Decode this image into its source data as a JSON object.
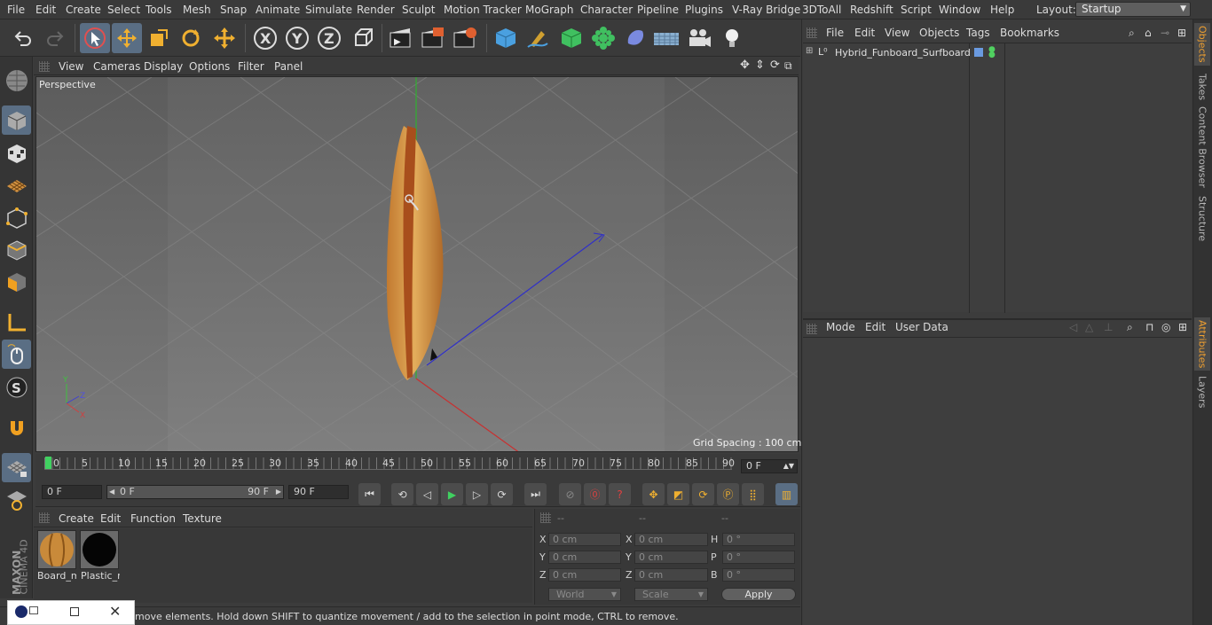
{
  "menubar": {
    "items": [
      "File",
      "Edit",
      "Create",
      "Select",
      "Tools",
      "Mesh",
      "Snap",
      "Animate",
      "Simulate",
      "Render",
      "Sculpt",
      "Motion Tracker",
      "MoGraph",
      "Character",
      "Pipeline",
      "Plugins",
      "V-Ray Bridge",
      "3DToAll",
      "Redshift",
      "Script",
      "Window",
      "Help"
    ],
    "layout_label": "Layout:",
    "layout_value": "Startup"
  },
  "toolbar": {
    "buttons": [
      "undo-icon",
      "redo-icon",
      "select-arrow-icon",
      "move-icon",
      "scale-icon",
      "rotate-icon",
      "move-alt-icon",
      "x-axis-icon",
      "y-axis-icon",
      "z-axis-icon",
      "coordinate-system-icon",
      "render-view-icon",
      "render-picture-viewer-icon",
      "render-settings-icon",
      "cube-icon",
      "pen-icon",
      "generator-icon",
      "cloner-icon",
      "deformer-icon",
      "floor-icon",
      "camera-icon",
      "light-icon"
    ]
  },
  "viewport": {
    "menu": [
      "View",
      "Cameras",
      "Display",
      "Options",
      "Filter",
      "Panel"
    ],
    "label": "Perspective",
    "grid_spacing": "Grid Spacing : 100 cm"
  },
  "timeline": {
    "ticks": [
      "0",
      "5",
      "10",
      "15",
      "20",
      "25",
      "30",
      "35",
      "40",
      "45",
      "50",
      "55",
      "60",
      "65",
      "70",
      "75",
      "80",
      "85",
      "90"
    ],
    "current_frame": "0 F",
    "start_field": "0 F",
    "range_start": "0 F",
    "range_end": "90 F",
    "end_field": "90 F"
  },
  "materials": {
    "menu": [
      "Create",
      "Edit",
      "Function",
      "Texture"
    ],
    "items": [
      {
        "label": "Board_m",
        "color": "#c98a3a"
      },
      {
        "label": "Plastic_r",
        "color": "#050505"
      }
    ]
  },
  "coordinates": {
    "headers": [
      "--",
      "--",
      "--"
    ],
    "rows": [
      {
        "pos_label": "X",
        "pos": "0 cm",
        "size_label": "X",
        "size": "0 cm",
        "rot_label": "H",
        "rot": "0 °"
      },
      {
        "pos_label": "Y",
        "pos": "0 cm",
        "size_label": "Y",
        "size": "0 cm",
        "rot_label": "P",
        "rot": "0 °"
      },
      {
        "pos_label": "Z",
        "pos": "0 cm",
        "size_label": "Z",
        "size": "0 cm",
        "rot_label": "B",
        "rot": "0 °"
      }
    ],
    "mode_world": "World",
    "mode_scale": "Scale",
    "apply": "Apply"
  },
  "status": {
    "text": "move elements. Hold down SHIFT to quantize movement / add to the selection in point mode, CTRL to remove."
  },
  "objects": {
    "menu": [
      "File",
      "Edit",
      "View",
      "Objects",
      "Tags",
      "Bookmarks"
    ],
    "items": [
      {
        "name": "Hybrid_Funboard_Surfboard"
      }
    ]
  },
  "attributes": {
    "menu": [
      "Mode",
      "Edit",
      "User Data"
    ]
  },
  "side_tabs": [
    "Objects",
    "Takes",
    "Content Browser",
    "Structure",
    "Attributes",
    "Layers"
  ],
  "brand": {
    "maxon": "MAXON",
    "product": "CINEMA 4D"
  },
  "colors": {
    "accent": "#5a6e84",
    "active_tab": "#f0a030",
    "board": "#d89a4a",
    "board_stripe": "#a8501c"
  }
}
